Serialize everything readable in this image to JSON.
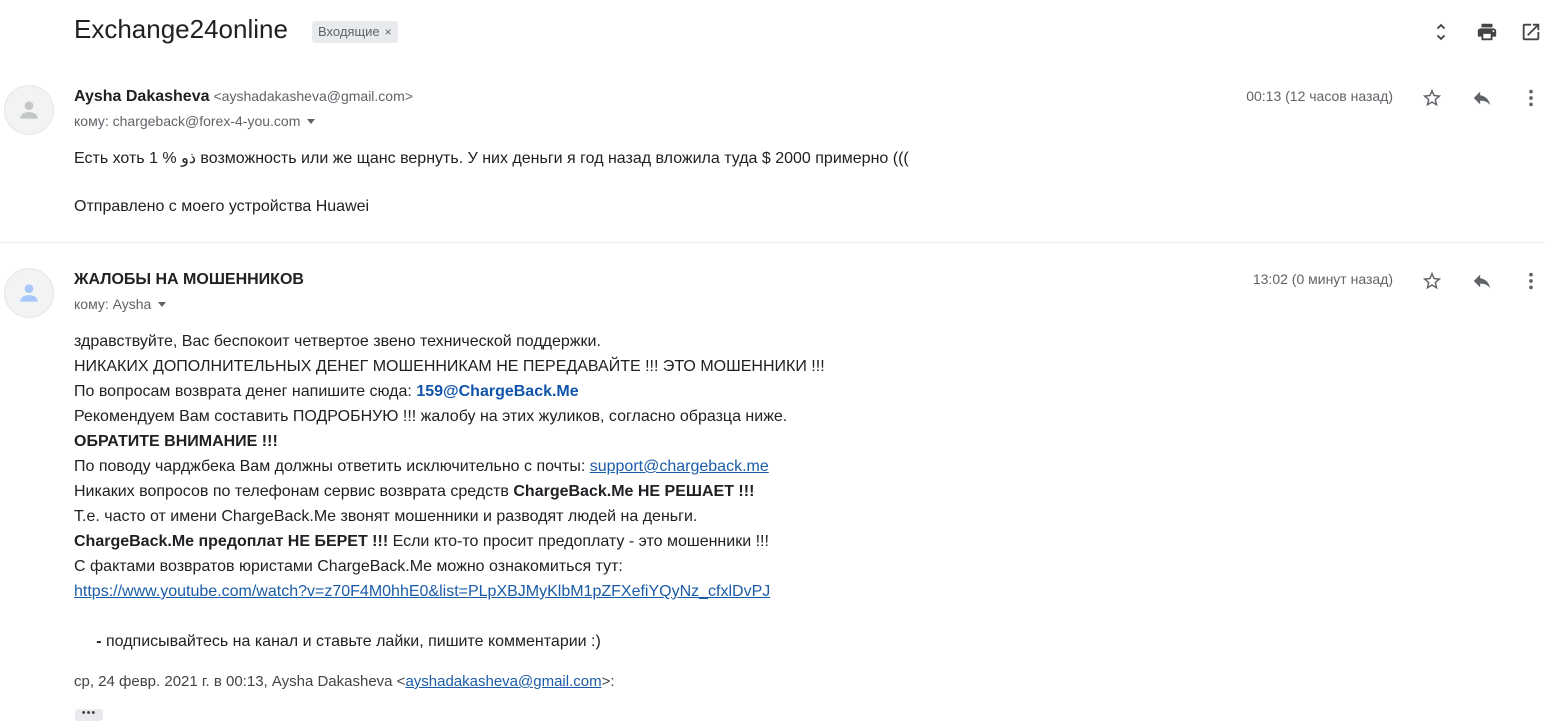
{
  "header": {
    "subject": "Exchange24online",
    "label": "Входящие",
    "label_close": "×"
  },
  "icons": {
    "expand": "unfold-icon",
    "print": "print-icon",
    "popout": "open-in-new-icon",
    "star": "star-icon",
    "reply": "reply-icon",
    "more": "more-vert-icon",
    "avatar": "person-icon"
  },
  "messages": [
    {
      "sender_name": "Aysha Dakasheva",
      "sender_email": "<ayshadakasheva@gmail.com>",
      "to": "кому: chargeback@forex-4-you.com",
      "date": "00:13 (12 часов назад)",
      "body": [
        "Есть хоть 1 % ذو возможность или же щанс вернуть. У них деньги я год назад вложила туда $ 2000 примерно (((",
        "Отправлено с моего устройства Huawei"
      ]
    },
    {
      "sender_name": "ЖАЛОБЫ НА МОШЕННИКОВ",
      "to": "кому: Aysha",
      "date": "13:02 (0 минут назад)",
      "body": {
        "l1": "здравствуйте, Вас беспокоит четвертое звено технической поддержки.",
        "l2": "НИКАКИХ ДОПОЛНИТЕЛЬНЫХ ДЕНЕГ МОШЕННИКАМ НЕ ПЕРЕДАВАЙТЕ !!! ЭТО МОШЕННИКИ !!!",
        "l3_text": "По вопросам возврата денег напишите сюда: ",
        "l3_link": "159@ChargeBack.Me",
        "l4": "Рекомендуем Вам составить ПОДРОБНУЮ !!! жалобу на этих жуликов, согласно образца ниже.",
        "l5": "ОБРАТИТЕ ВНИМАНИЕ !!!",
        "l6_text": "По поводу чарджбека Вам должны ответить исключительно с почты: ",
        "l6_link": "support@chargeback.me",
        "l7_text": "Никаких вопросов по телефонам сервис возврата средств ",
        "l7_bold": "ChargeBack.Me НЕ РЕШАЕТ !!!",
        "l8": "Т.е. часто от имени ChargeBack.Me звонят мошенники и разводят людей на деньги.",
        "l9_bold": "ChargeBack.Me предоплат НЕ БЕРЕТ !!!",
        "l9_text": " Если кто-то просит предоплату - это мошенники !!!",
        "l10": "С фактами возвратов юристами ChargeBack.Me можно ознакомиться тут:",
        "l11_link": "https://www.youtube.com/watch?v=z70F4M0hhE0&list=PLpXBJMyKlbM1pZFXefiYQyNz_cfxlDvPJ",
        "l12_bold": " - ",
        "l12_text": "подписывайтесь на канал и ставьте лайки, пишите комментарии :)",
        "quote_text": "ср, 24 февр. 2021 г. в 00:13, Aysha Dakasheva <",
        "quote_link": "ayshadakasheva@gmail.com",
        "quote_end": ">:",
        "show_trimmed": "•••"
      }
    }
  ]
}
